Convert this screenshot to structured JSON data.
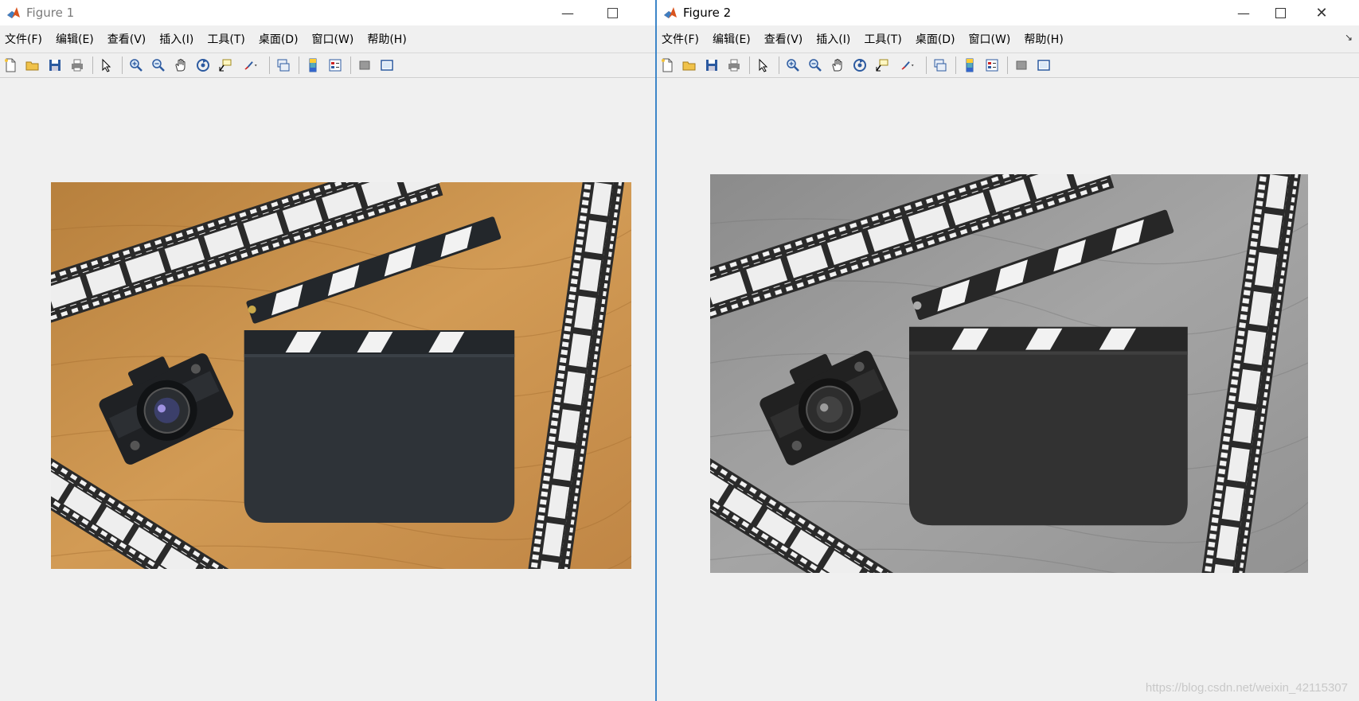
{
  "windows": [
    {
      "title": "Figure 1",
      "active": false,
      "menu": [
        "文件(F)",
        "编辑(E)",
        "查看(V)",
        "插入(I)",
        "工具(T)",
        "桌面(D)",
        "窗口(W)",
        "帮助(H)"
      ],
      "image": "color"
    },
    {
      "title": "Figure 2",
      "active": true,
      "menu": [
        "文件(F)",
        "编辑(E)",
        "查看(V)",
        "插入(I)",
        "工具(T)",
        "桌面(D)",
        "窗口(W)",
        "帮助(H)"
      ],
      "image": "grayscale"
    }
  ],
  "toolbar_icons": [
    "new-figure-icon",
    "open-file-icon",
    "save-icon",
    "print-icon",
    "select-arrow-icon",
    "zoom-in-icon",
    "zoom-out-icon",
    "pan-hand-icon",
    "rotate-3d-icon",
    "data-cursor-icon",
    "brush-icon",
    "link-plot-icon",
    "colorbar-icon",
    "legend-icon",
    "hide-plot-tools-icon",
    "show-plot-tools-icon"
  ],
  "watermark": "https://blog.csdn.net/weixin_42115307",
  "colors": {
    "wood": "#c9934a",
    "clapper": "#2b2f33",
    "accent_blue": "#3d86c8"
  }
}
